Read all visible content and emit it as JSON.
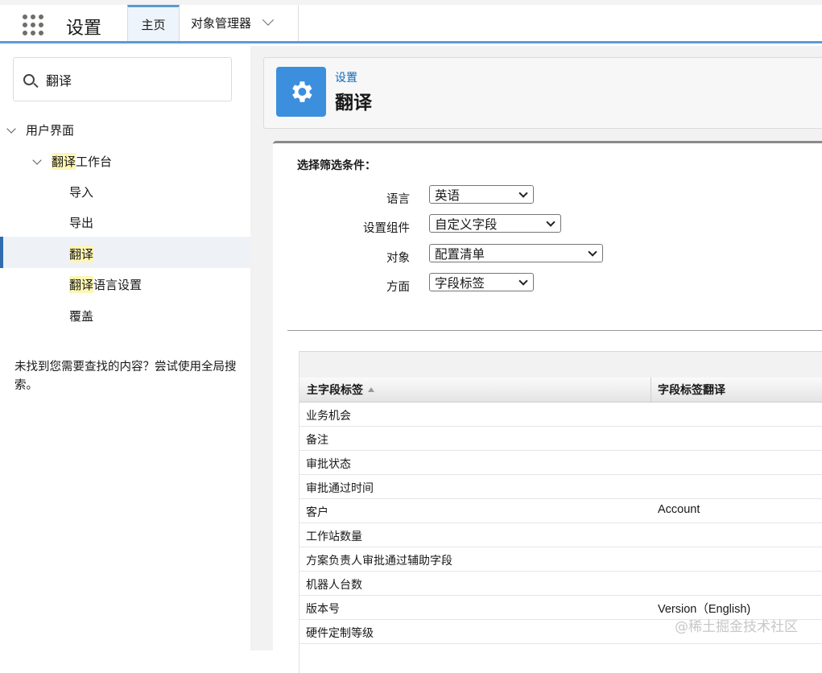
{
  "app": {
    "title": "设置"
  },
  "tabs": [
    {
      "label": "主页",
      "active": true
    },
    {
      "label": "对象管理器",
      "active": false
    }
  ],
  "sidebar": {
    "search": {
      "value": "翻译",
      "placeholder": ""
    },
    "tree": {
      "section": "用户界面",
      "group": {
        "label_hl": "翻译",
        "label_rest": "工作台"
      },
      "items": [
        {
          "label_hl": "",
          "label_rest": "导入"
        },
        {
          "label_hl": "",
          "label_rest": "导出"
        },
        {
          "label_hl": "翻译",
          "label_rest": "",
          "active": true
        },
        {
          "label_hl": "翻译",
          "label_rest": "语言设置"
        },
        {
          "label_hl": "",
          "label_rest": "覆盖"
        }
      ]
    },
    "help_text": "未找到您需要查找的内容？尝试使用全局搜索。"
  },
  "header": {
    "breadcrumb": "设置",
    "title": "翻译"
  },
  "filters": {
    "title": "选择筛选条件：",
    "rows": [
      {
        "label": "语言",
        "value": "英语"
      },
      {
        "label": "设置组件",
        "value": "自定义字段"
      },
      {
        "label": "对象",
        "value": "配置清单"
      },
      {
        "label": "方面",
        "value": "字段标签"
      }
    ]
  },
  "table": {
    "columns": [
      "主字段标签",
      "字段标签翻译"
    ],
    "rows": [
      {
        "label": "业务机会",
        "translation": ""
      },
      {
        "label": "备注",
        "translation": ""
      },
      {
        "label": "审批状态",
        "translation": ""
      },
      {
        "label": "审批通过时间",
        "translation": ""
      },
      {
        "label": "客户",
        "translation": "Account"
      },
      {
        "label": "工作站数量",
        "translation": ""
      },
      {
        "label": "方案负责人审批通过辅助字段",
        "translation": ""
      },
      {
        "label": "机器人台数",
        "translation": ""
      },
      {
        "label": "版本号",
        "translation": "Version（English)"
      },
      {
        "label": "硬件定制等级",
        "translation": ""
      }
    ]
  },
  "watermark": "@稀土掘金技术社区",
  "colors": {
    "accent": "#5b9bd5",
    "gear_tile": "#3c8fdd",
    "link": "#0b6bbf",
    "highlight": "#fdf6b4"
  }
}
